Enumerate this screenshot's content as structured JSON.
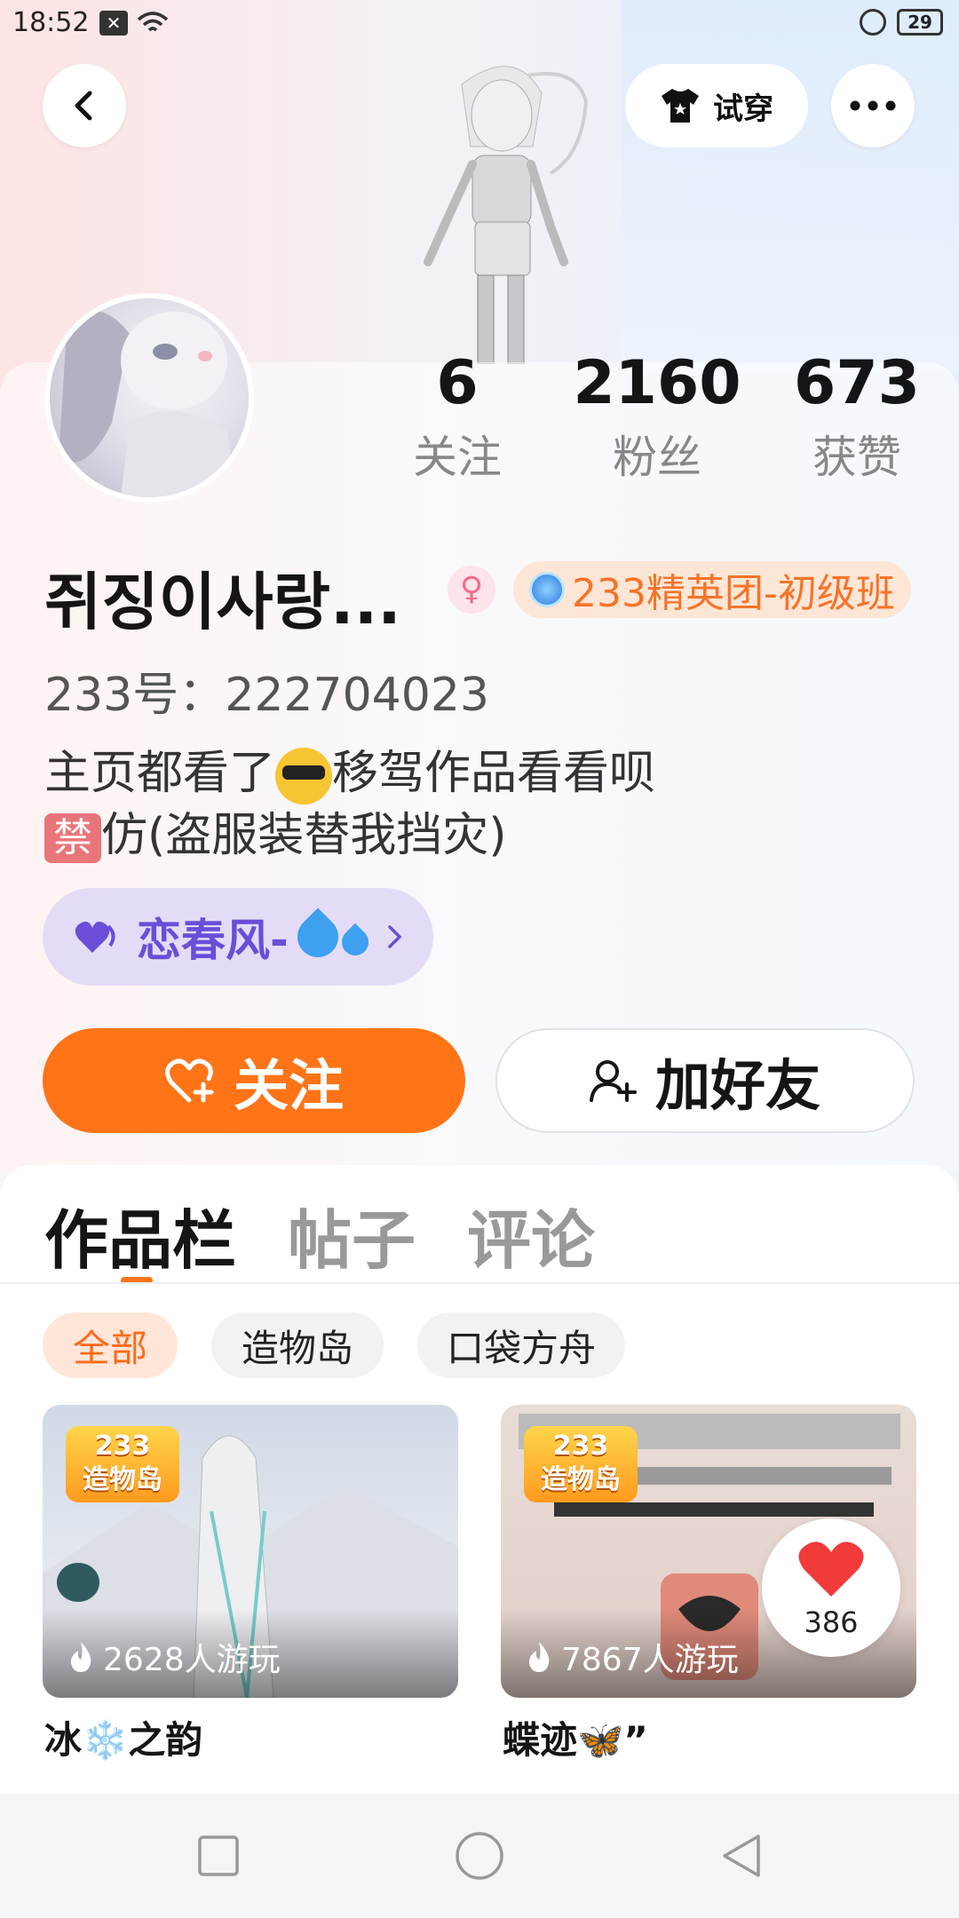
{
  "status_bar": {
    "time": "18:52",
    "battery": "29"
  },
  "header": {
    "tryon_label": "试穿"
  },
  "stats": [
    {
      "value": "6",
      "label": "关注"
    },
    {
      "value": "2160",
      "label": "粉丝"
    },
    {
      "value": "673",
      "label": "获赞"
    }
  ],
  "profile": {
    "username": "쥐징이사랑...",
    "gender_symbol": "♀",
    "title_badge": "233精英团-初级班",
    "uid": "233号：222704023",
    "bio_line1_a": "主页都看了",
    "bio_line1_b": "移驾作品看看呗",
    "bio_line2_emoji": "禁",
    "bio_line2": "仿(盗服装替我挡灾)",
    "music_chip": "恋春风-"
  },
  "actions": {
    "follow": "关注",
    "add_friend": "加好友"
  },
  "tabs": [
    "作品栏",
    "帖子",
    "评论"
  ],
  "filters": [
    "全部",
    "造物岛",
    "口袋方舟"
  ],
  "logo_text": [
    "233",
    "造物岛"
  ],
  "works": [
    {
      "plays": "2628人游玩",
      "title": "冰❄️之韵"
    },
    {
      "plays": "7867人游玩",
      "title": "蝶迹🦋”"
    }
  ],
  "like_count": "386",
  "colors": {
    "accent": "#ff7417",
    "music": "#6b4dd8"
  }
}
